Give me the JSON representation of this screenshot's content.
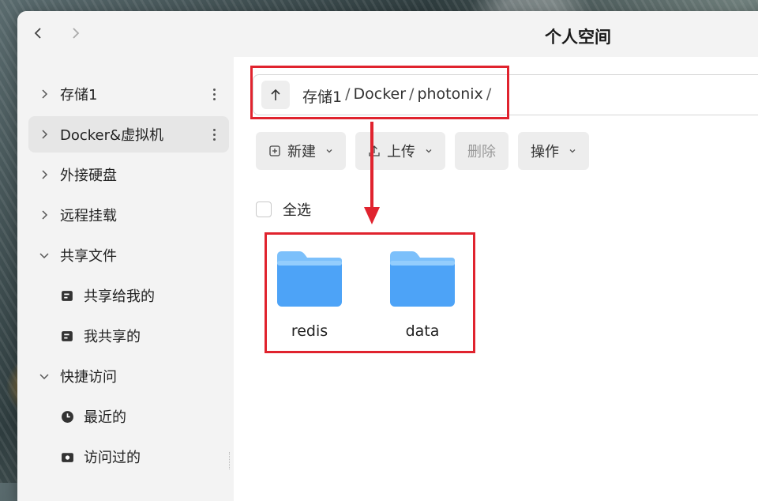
{
  "window": {
    "title": "个人空间"
  },
  "sidebar": {
    "items": [
      {
        "label": "存储1",
        "expanded": false,
        "has_more": true
      },
      {
        "label": "Docker&虚拟机",
        "expanded": false,
        "has_more": true,
        "active": true
      },
      {
        "label": "外接硬盘",
        "expanded": false
      },
      {
        "label": "远程挂载",
        "expanded": false
      },
      {
        "label": "共享文件",
        "expanded": true
      },
      {
        "label": "共享给我的",
        "icon": "share-to-me-icon"
      },
      {
        "label": "我共享的",
        "icon": "my-share-icon"
      },
      {
        "label": "快捷访问",
        "expanded": true
      },
      {
        "label": "最近的",
        "icon": "clock-icon"
      },
      {
        "label": "访问过的",
        "icon": "visited-icon"
      }
    ]
  },
  "path": {
    "segments": [
      "存储1",
      "Docker",
      "photonix"
    ],
    "separator": "/"
  },
  "toolbar": {
    "new_label": "新建",
    "upload_label": "上传",
    "delete_label": "删除",
    "actions_label": "操作"
  },
  "select_all_label": "全选",
  "files": [
    {
      "name": "redis",
      "type": "folder"
    },
    {
      "name": "data",
      "type": "folder"
    }
  ],
  "colors": {
    "highlight": "#e0232e",
    "folder": "#4da3f7"
  }
}
